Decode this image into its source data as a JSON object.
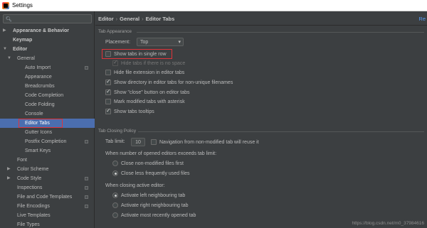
{
  "window": {
    "title": "Settings"
  },
  "search": {
    "icon": "search-icon",
    "value": ""
  },
  "sidebar": {
    "items": [
      {
        "label": "Appearance & Behavior",
        "bold": true,
        "arrow": "▶",
        "indent": 0
      },
      {
        "label": "Keymap",
        "bold": true,
        "arrow": "",
        "indent": 0
      },
      {
        "label": "Editor",
        "bold": true,
        "arrow": "▼",
        "indent": 0
      },
      {
        "label": "General",
        "bold": false,
        "arrow": "▼",
        "indent": 1
      },
      {
        "label": "Auto Import",
        "indent": 2,
        "badge": true
      },
      {
        "label": "Appearance",
        "indent": 2
      },
      {
        "label": "Breadcrumbs",
        "indent": 2
      },
      {
        "label": "Code Completion",
        "indent": 2
      },
      {
        "label": "Code Folding",
        "indent": 2
      },
      {
        "label": "Console",
        "indent": 2
      },
      {
        "label": "Editor Tabs",
        "indent": 2,
        "selected": true
      },
      {
        "label": "Gutter Icons",
        "indent": 2
      },
      {
        "label": "Postfix Completion",
        "indent": 2,
        "badge": true
      },
      {
        "label": "Smart Keys",
        "indent": 2
      },
      {
        "label": "Font",
        "indent": 1
      },
      {
        "label": "Color Scheme",
        "arrow": "▶",
        "indent": 1
      },
      {
        "label": "Code Style",
        "arrow": "▶",
        "indent": 1,
        "badge": true
      },
      {
        "label": "Inspections",
        "indent": 1,
        "badge": true
      },
      {
        "label": "File and Code Templates",
        "indent": 1,
        "badge": true
      },
      {
        "label": "File Encodings",
        "indent": 1,
        "badge": true
      },
      {
        "label": "Live Templates",
        "indent": 1
      },
      {
        "label": "File Types",
        "indent": 1
      }
    ]
  },
  "breadcrumb": {
    "part1": "Editor",
    "sep1": "›",
    "part2": "General",
    "sep2": "›",
    "part3": "Editor Tabs"
  },
  "reset_label": "Re",
  "tab_appearance": {
    "title": "Tab Appearance",
    "placement_label": "Placement:",
    "placement_value": "Top",
    "options": [
      {
        "label": "Show tabs in single row",
        "checked": false
      },
      {
        "label": "Hide tabs if there is no space",
        "checked": true,
        "disabled": true
      },
      {
        "label": "Hide file extension in editor tabs",
        "checked": false
      },
      {
        "label": "Show directory in editor tabs for non-unique filenames",
        "checked": true
      },
      {
        "label": "Show \"close\" button on editor tabs",
        "checked": true
      },
      {
        "label": "Mark modified tabs with asterisk",
        "checked": false
      },
      {
        "label": "Show tabs tooltips",
        "checked": true
      }
    ]
  },
  "tab_closing": {
    "title": "Tab Closing Policy",
    "tab_limit_label": "Tab limit:",
    "tab_limit_value": "10",
    "reuse_label": "Navigation from non-modified tab will reuse it",
    "exceeds_label": "When number of opened editors exceeds tab limit:",
    "exceeds_options": [
      {
        "label": "Close non-modified files first",
        "checked": false
      },
      {
        "label": "Close less frequently used files",
        "checked": true
      }
    ],
    "closing_label": "When closing active editor:",
    "closing_options": [
      {
        "label": "Activate left neighbouring tab",
        "checked": true
      },
      {
        "label": "Activate right neighbouring tab",
        "checked": false
      },
      {
        "label": "Activate most recently opened tab",
        "checked": false
      }
    ]
  },
  "watermark": "https://blog.csdn.net/m0_37984616"
}
